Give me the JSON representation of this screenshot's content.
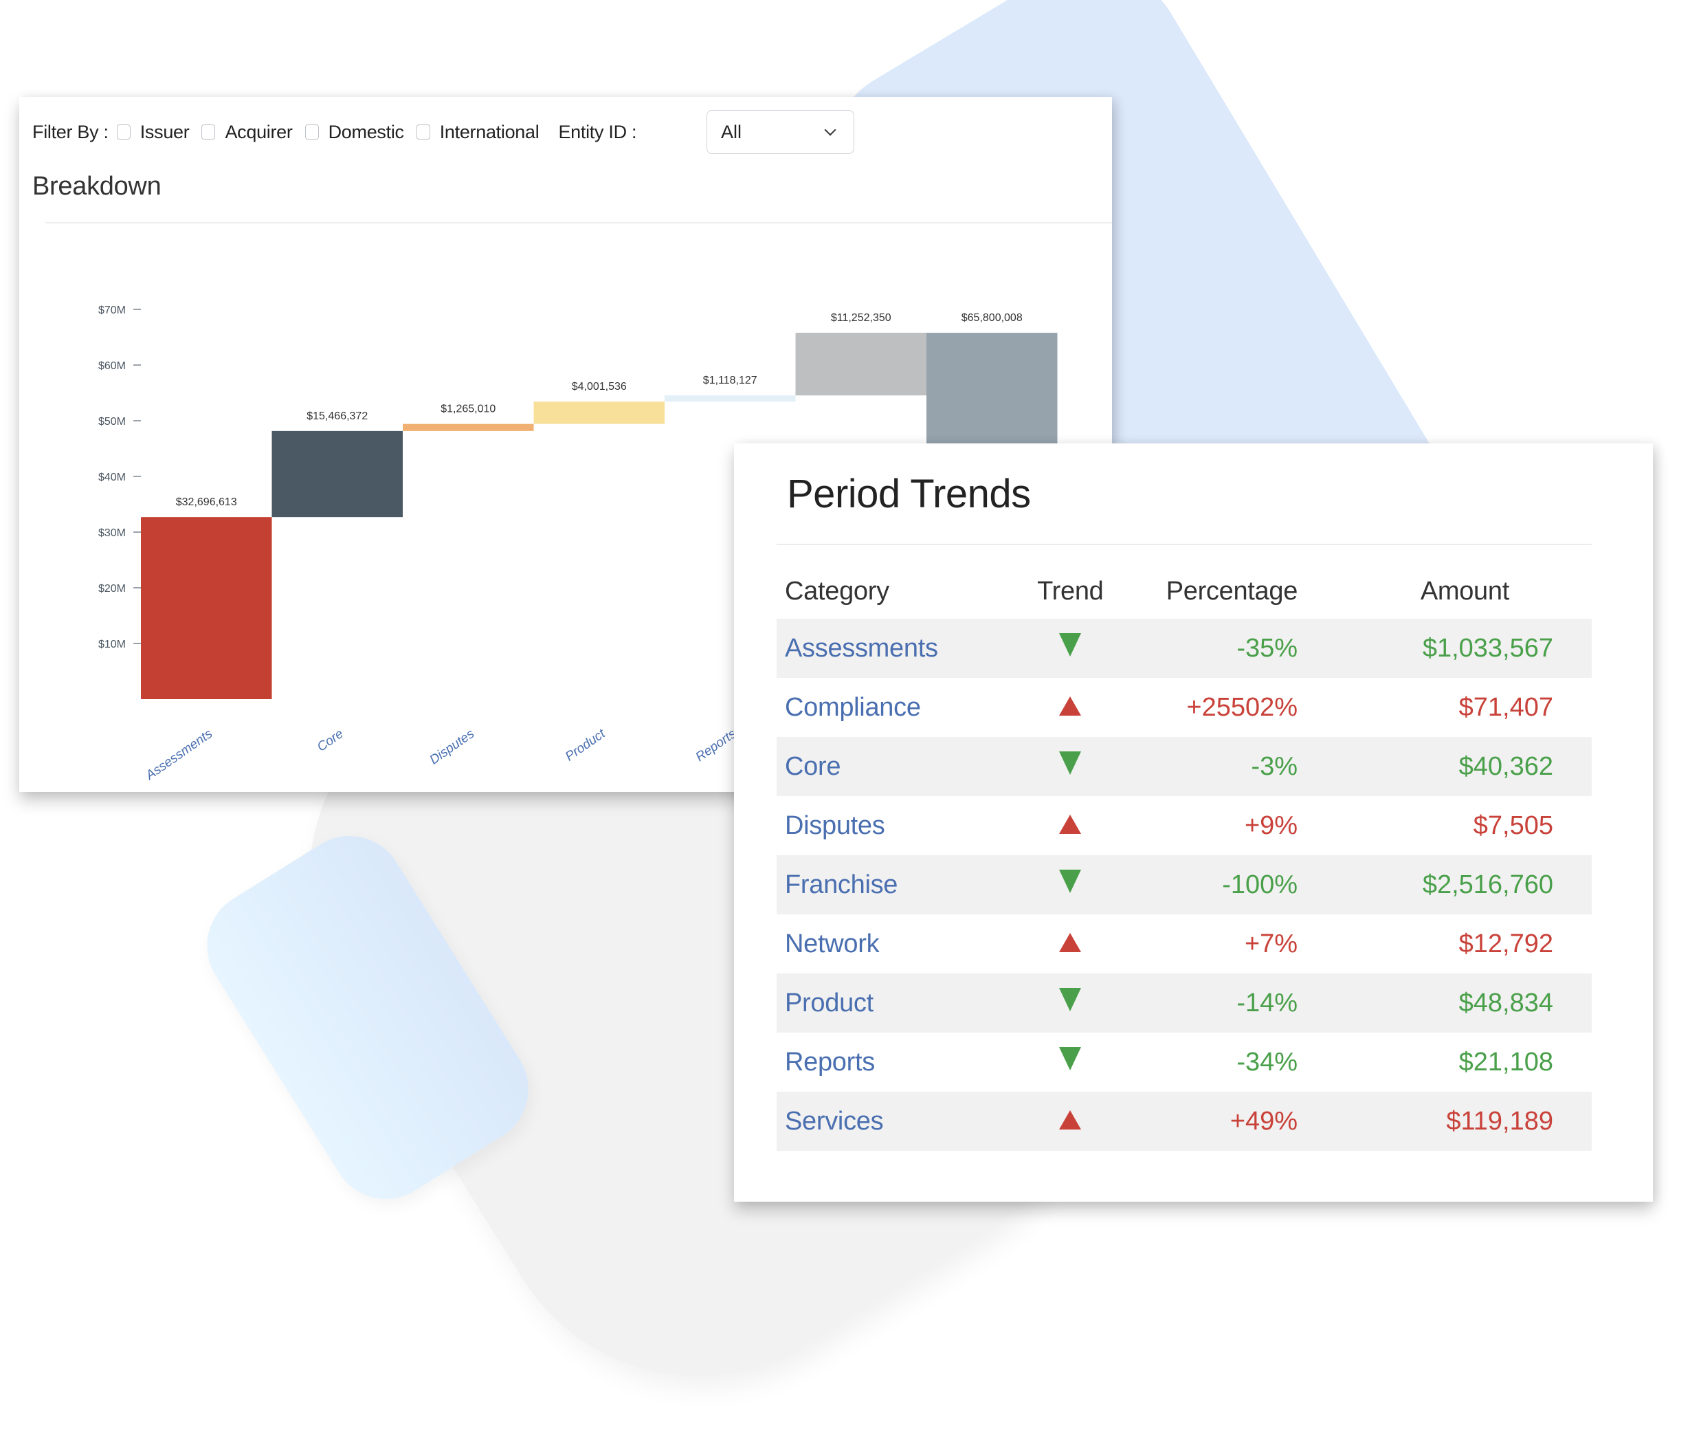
{
  "filters": {
    "label": "Filter By :",
    "options": [
      {
        "label": "Issuer",
        "checked": false
      },
      {
        "label": "Acquirer",
        "checked": false
      },
      {
        "label": "Domestic",
        "checked": false
      },
      {
        "label": "International",
        "checked": false
      }
    ],
    "entity_label": "Entity ID :",
    "entity_value": "All"
  },
  "breakdown": {
    "title": "Breakdown"
  },
  "chart_data": {
    "type": "bar",
    "subtype": "waterfall",
    "title": "Breakdown",
    "xlabel": "",
    "ylabel": "",
    "ylim": [
      0,
      70000000
    ],
    "yticks": [
      10000000,
      20000000,
      30000000,
      40000000,
      50000000,
      60000000,
      70000000
    ],
    "ytick_labels": [
      "$10M",
      "$20M",
      "$30M",
      "$40M",
      "$50M",
      "$60M",
      "$70M"
    ],
    "grid": false,
    "categories": [
      "Assessments",
      "Core",
      "Disputes",
      "Product",
      "Reports",
      "",
      ""
    ],
    "values": [
      32696613,
      15466372,
      1265010,
      4001536,
      1118127,
      11252350,
      65800008
    ],
    "value_labels": [
      "$32,696,613",
      "$15,466,372",
      "$1,265,010",
      "$4,001,536",
      "$1,118,127",
      "$11,252,350",
      "$65,800,008"
    ],
    "is_total": [
      false,
      false,
      false,
      false,
      false,
      false,
      true
    ],
    "colors": [
      "#c44032",
      "#4a5964",
      "#f0b072",
      "#f8e09b",
      "#e3f0f8",
      "#bdbfc1",
      "#96a3ad"
    ]
  },
  "trends": {
    "title": "Period Trends",
    "columns": [
      "Category",
      "Trend",
      "Percentage",
      "Amount"
    ],
    "colors": {
      "down": "#4aa04a",
      "up": "#c9423a",
      "category": "#4a6fb0"
    },
    "rows": [
      {
        "category": "Assessments",
        "trend": "down",
        "percentage": "-35%",
        "amount": "$1,033,567"
      },
      {
        "category": "Compliance",
        "trend": "up",
        "percentage": "+25502%",
        "amount": "$71,407"
      },
      {
        "category": "Core",
        "trend": "down",
        "percentage": "-3%",
        "amount": "$40,362"
      },
      {
        "category": "Disputes",
        "trend": "up",
        "percentage": "+9%",
        "amount": "$7,505"
      },
      {
        "category": "Franchise",
        "trend": "down",
        "percentage": "-100%",
        "amount": "$2,516,760"
      },
      {
        "category": "Network",
        "trend": "up",
        "percentage": "+7%",
        "amount": "$12,792"
      },
      {
        "category": "Product",
        "trend": "down",
        "percentage": "-14%",
        "amount": "$48,834"
      },
      {
        "category": "Reports",
        "trend": "down",
        "percentage": "-34%",
        "amount": "$21,108"
      },
      {
        "category": "Services",
        "trend": "up",
        "percentage": "+49%",
        "amount": "$119,189"
      }
    ]
  }
}
